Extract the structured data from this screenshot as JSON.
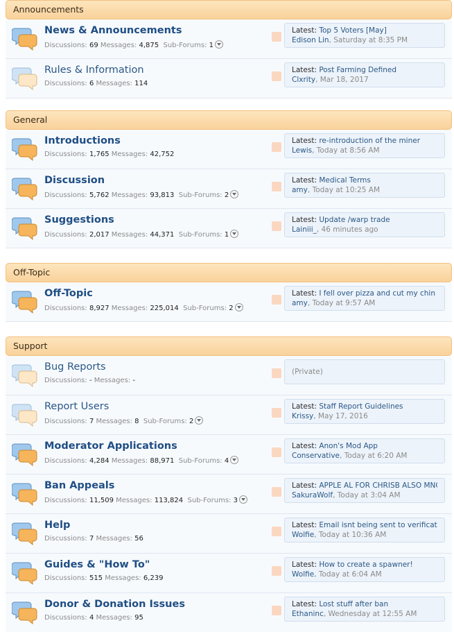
{
  "categories": [
    {
      "title": "Announcements",
      "nodes": [
        {
          "title": "News & Announcements",
          "unread": true,
          "discussions": "69",
          "messages": "4,875",
          "sub_forums": "1",
          "latest_label": "Latest:",
          "latest_title": "Top 5 Voters [May]",
          "latest_user": "Edison Lin",
          "latest_time": "Saturday at 8:35 PM"
        },
        {
          "title": "Rules & Information",
          "unread": false,
          "discussions": "6",
          "messages": "114",
          "sub_forums": null,
          "latest_label": "Latest:",
          "latest_title": "Post Farming Defined",
          "latest_user": "Clxrity",
          "latest_time": "Mar 18, 2017"
        }
      ]
    },
    {
      "title": "General",
      "nodes": [
        {
          "title": "Introductions",
          "unread": true,
          "discussions": "1,765",
          "messages": "42,752",
          "sub_forums": null,
          "latest_label": "Latest:",
          "latest_title": "re-introduction of the miner",
          "latest_user": "Lewis",
          "latest_time": "Today at 8:56 AM"
        },
        {
          "title": "Discussion",
          "unread": true,
          "discussions": "5,762",
          "messages": "93,813",
          "sub_forums": "2",
          "latest_label": "Latest:",
          "latest_title": "Medical Terms",
          "latest_user": "amy",
          "latest_time": "Today at 10:25 AM"
        },
        {
          "title": "Suggestions",
          "unread": true,
          "discussions": "2,017",
          "messages": "44,371",
          "sub_forums": "1",
          "latest_label": "Latest:",
          "latest_title": "Update /warp trade",
          "latest_user": "Lainiii_",
          "latest_time": "46 minutes ago"
        }
      ]
    },
    {
      "title": "Off-Topic",
      "nodes": [
        {
          "title": "Off-Topic",
          "unread": true,
          "discussions": "8,927",
          "messages": "225,014",
          "sub_forums": "2",
          "latest_label": "Latest:",
          "latest_title": "I fell over pizza and cut my chin ...",
          "latest_user": "amy",
          "latest_time": "Today at 9:57 AM"
        }
      ]
    },
    {
      "title": "Support",
      "nodes": [
        {
          "title": "Bug Reports",
          "unread": false,
          "discussions": "-",
          "messages": "-",
          "sub_forums": null,
          "private": "(Private)"
        },
        {
          "title": "Report Users",
          "unread": false,
          "discussions": "7",
          "messages": "8",
          "sub_forums": "2",
          "latest_label": "Latest:",
          "latest_title": "Staff Report Guidelines",
          "latest_user": "Krissy",
          "latest_time": "May 17, 2016"
        },
        {
          "title": "Moderator Applications",
          "unread": true,
          "discussions": "4,284",
          "messages": "88,971",
          "sub_forums": "4",
          "latest_label": "Latest:",
          "latest_title": "Anon's Mod App",
          "latest_user": "Conservative",
          "latest_time": "Today at 6:20 AM"
        },
        {
          "title": "Ban Appeals",
          "unread": true,
          "discussions": "11,509",
          "messages": "113,824",
          "sub_forums": "3",
          "latest_label": "Latest:",
          "latest_title": "APPLE AL FOR CHRISB ALSO MNO...",
          "latest_user": "SakuraWolf",
          "latest_time": "Today at 3:04 AM"
        },
        {
          "title": "Help",
          "unread": true,
          "discussions": "7",
          "messages": "56",
          "sub_forums": null,
          "latest_label": "Latest:",
          "latest_title": "Email isnt being sent to verificat...",
          "latest_user": "Wolfie",
          "latest_time": "Today at 10:36 AM"
        },
        {
          "title": "Guides & \"How To\"",
          "unread": true,
          "discussions": "515",
          "messages": "6,239",
          "sub_forums": null,
          "latest_label": "Latest:",
          "latest_title": "How to create a spawner!",
          "latest_user": "Wolfie",
          "latest_time": "Today at 6:04 AM"
        },
        {
          "title": "Donor & Donation Issues",
          "unread": true,
          "discussions": "4",
          "messages": "95",
          "sub_forums": null,
          "latest_label": "Latest:",
          "latest_title": "Lost stuff after ban",
          "latest_user": "Ethaninc",
          "latest_time": "Wednesday at 12:55 AM"
        }
      ]
    }
  ],
  "labels": {
    "discussions": "Discussions:",
    "messages": "Messages:",
    "sub_forums": "Sub-Forums:"
  },
  "icons": {
    "node_unread": "chat-bubbles-unread-icon",
    "node_read": "chat-bubbles-read-icon",
    "rss": "rss-feed-icon",
    "sub_forums_menu": "chevron-down-icon"
  },
  "colors": {
    "header_bg": "#f9d29b",
    "node_title": "#2a5886",
    "latest_bg": "#edf3fa"
  }
}
